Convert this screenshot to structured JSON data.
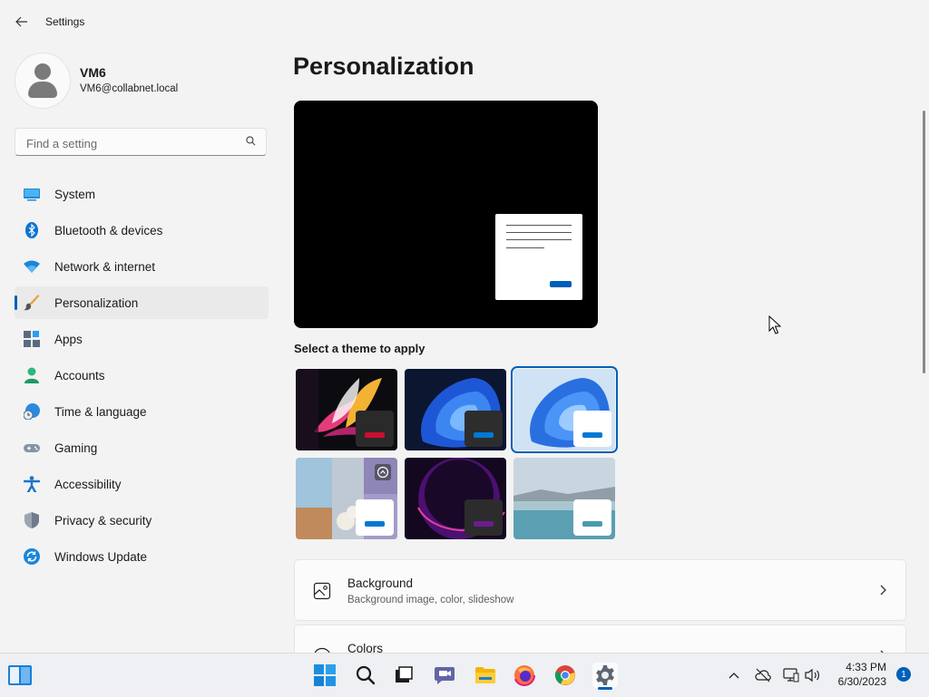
{
  "window": {
    "title": "Settings"
  },
  "user": {
    "name": "VM6",
    "email": "VM6@collabnet.local"
  },
  "search": {
    "placeholder": "Find a setting"
  },
  "sidebar": {
    "items": [
      {
        "label": "System",
        "icon": "system-icon"
      },
      {
        "label": "Bluetooth & devices",
        "icon": "bluetooth-icon"
      },
      {
        "label": "Network & internet",
        "icon": "wifi-icon"
      },
      {
        "label": "Personalization",
        "icon": "paintbrush-icon",
        "active": true
      },
      {
        "label": "Apps",
        "icon": "apps-icon"
      },
      {
        "label": "Accounts",
        "icon": "person-icon"
      },
      {
        "label": "Time & language",
        "icon": "globe-clock-icon"
      },
      {
        "label": "Gaming",
        "icon": "gamepad-icon"
      },
      {
        "label": "Accessibility",
        "icon": "accessibility-icon"
      },
      {
        "label": "Privacy & security",
        "icon": "shield-icon"
      },
      {
        "label": "Windows Update",
        "icon": "update-icon"
      }
    ]
  },
  "main": {
    "title": "Personalization",
    "themes_label": "Select a theme to apply",
    "themes": [
      {
        "name": "glow-flower",
        "accent": "#c8102e",
        "selected": false
      },
      {
        "name": "windows-dark",
        "accent": "#0078d4",
        "selected": false
      },
      {
        "name": "windows-light",
        "accent": "#0078d4",
        "selected": true
      },
      {
        "name": "captured-motion",
        "accent": "#0078d4",
        "selected": false
      },
      {
        "name": "glow",
        "accent": "#6b1d8c",
        "selected": false
      },
      {
        "name": "sunrise-lake",
        "accent": "#4a9bb0",
        "selected": false
      }
    ],
    "cards": [
      {
        "title": "Background",
        "subtitle": "Background image, color, slideshow",
        "icon": "image-icon"
      },
      {
        "title": "Colors",
        "subtitle": "",
        "icon": "palette-icon"
      }
    ]
  },
  "taskbar": {
    "clock_time": "4:33 PM",
    "clock_date": "6/30/2023",
    "notification_count": "1"
  },
  "colors": {
    "accent": "#005fb8",
    "window_bg": "#f3f3f3",
    "taskbar_bg": "#eef0f3"
  }
}
